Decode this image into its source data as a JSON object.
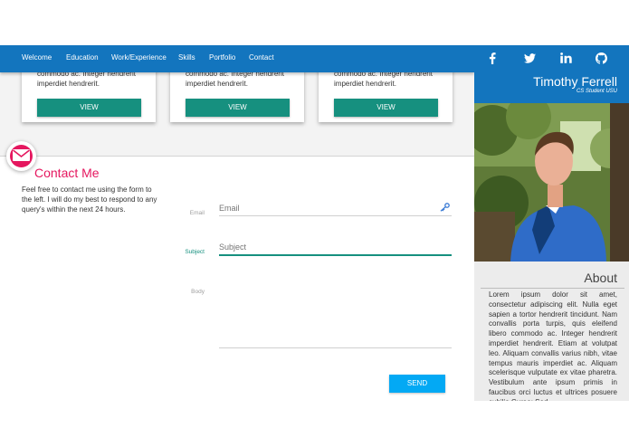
{
  "nav": {
    "items": [
      "Welcome",
      "Education",
      "Work/Experience",
      "Skills",
      "Portfolio",
      "Contact"
    ]
  },
  "cards": [
    {
      "text": "commodo ac. Integer hendrerit imperdiet hendrerit.",
      "button": "VIEW"
    },
    {
      "text": "commodo ac. Integer hendrerit imperdiet hendrerit.",
      "button": "VIEW"
    },
    {
      "text": "commodo ac. Integer hendrerit imperdiet hendrerit.",
      "button": "VIEW"
    }
  ],
  "contact": {
    "icon": "envelope-icon",
    "title": "Contact Me",
    "description": "Feel free to contact me using the form to the left. I will do my best to respond to any query's within the next 24 hours.",
    "form": {
      "email": {
        "label": "Email",
        "placeholder": "Email"
      },
      "subject": {
        "label": "Subject",
        "placeholder": "Subject"
      },
      "body": {
        "label": "Body",
        "placeholder": ""
      },
      "send_label": "SEND"
    }
  },
  "sidebar": {
    "social_icons": [
      "facebook-icon",
      "twitter-icon",
      "linkedin-icon",
      "github-icon"
    ],
    "name": "Timothy Ferrell",
    "subtitle": "CS Student USU",
    "about_title": "About",
    "about_text": "Lorem ipsum dolor sit amet, consectetur adipiscing elit. Nulla eget sapien a tortor hendrerit tincidunt. Nam convallis porta turpis, quis eleifend libero commodo ac. Integer hendrerit imperdiet hendrerit. Etiam at volutpat leo. Aliquam convallis varius nibh, vitae tempus mauris imperdiet ac. Aliquam scelerisque vulputate ex vitae pharetra. Vestibulum ante ipsum primis in faucibus orci luctus et ultrices posuere cubilia Curae; Sed"
  },
  "colors": {
    "primary": "#1375be",
    "accent_pink": "#e5175f",
    "teal": "#16907f",
    "send_blue": "#03a9f4"
  }
}
